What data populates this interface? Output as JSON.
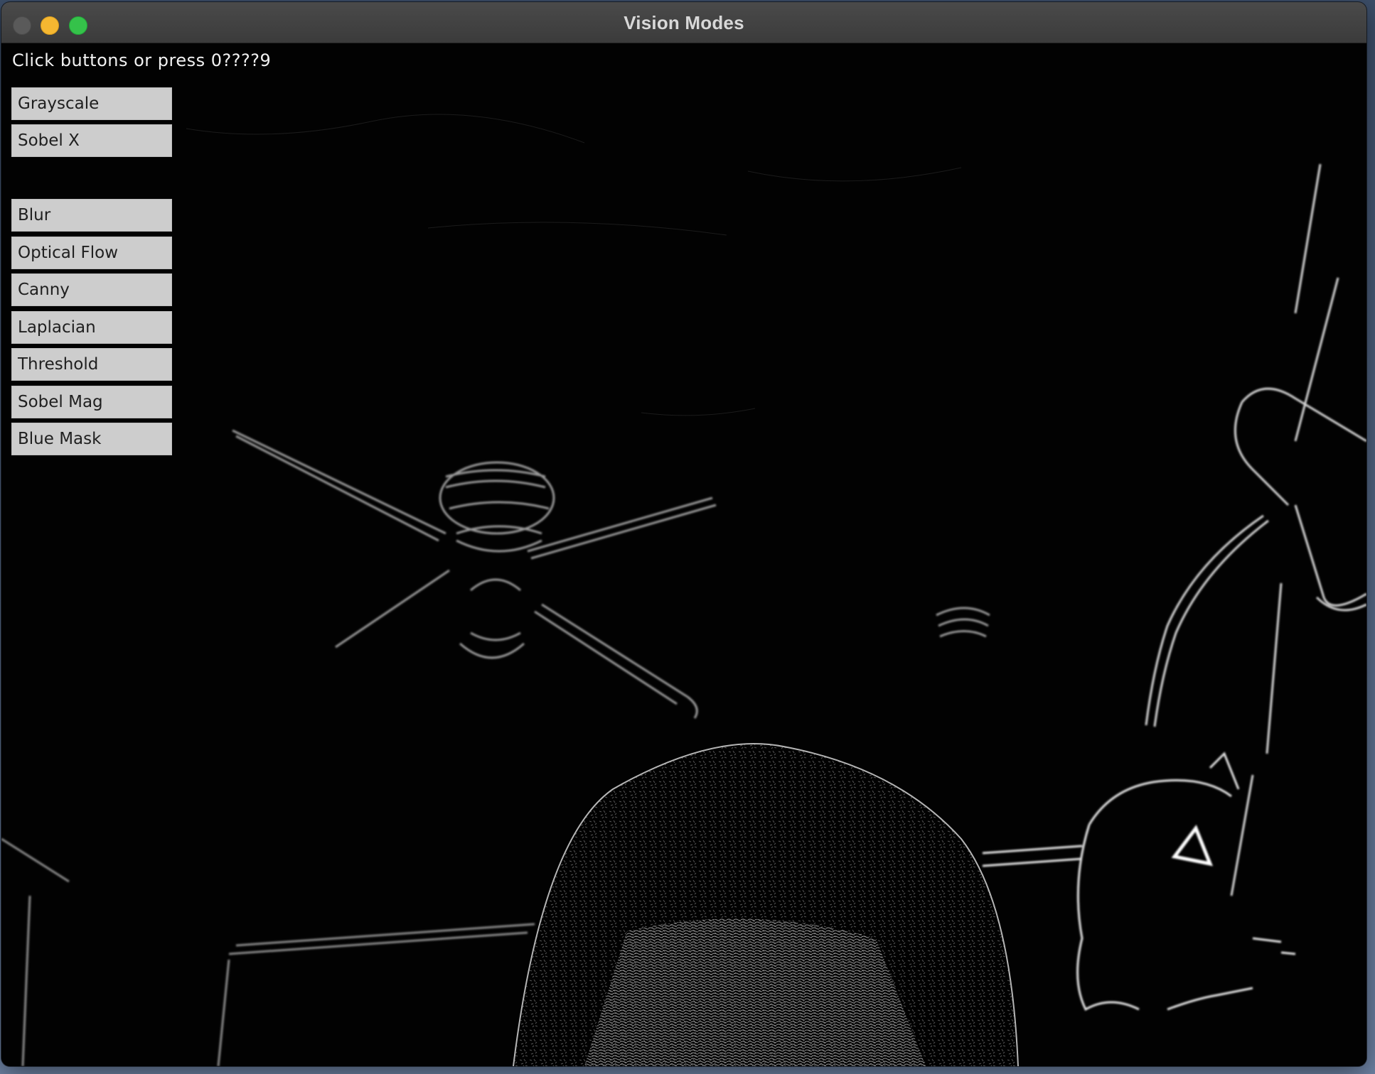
{
  "window": {
    "title": "Vision Modes"
  },
  "hint": "Click buttons or press 0????9",
  "buttons": [
    {
      "label": "Grayscale"
    },
    {
      "label": "Sobel X"
    },
    {
      "label": "Blur"
    },
    {
      "label": "Optical Flow"
    },
    {
      "label": "Canny"
    },
    {
      "label": "Laplacian"
    },
    {
      "label": "Threshold"
    },
    {
      "label": "Sobel Mag"
    },
    {
      "label": "Blue Mask"
    }
  ],
  "colors": {
    "background": "#020202",
    "button": "#cdcdcd",
    "button_text": "#1f1f1f",
    "hint_text": "#f2f2f2",
    "edges": "#e8e8e8"
  },
  "icons": {
    "close": "close-traffic-light-icon",
    "minimize": "minimize-traffic-light-icon",
    "maximize": "maximize-traffic-light-icon"
  }
}
